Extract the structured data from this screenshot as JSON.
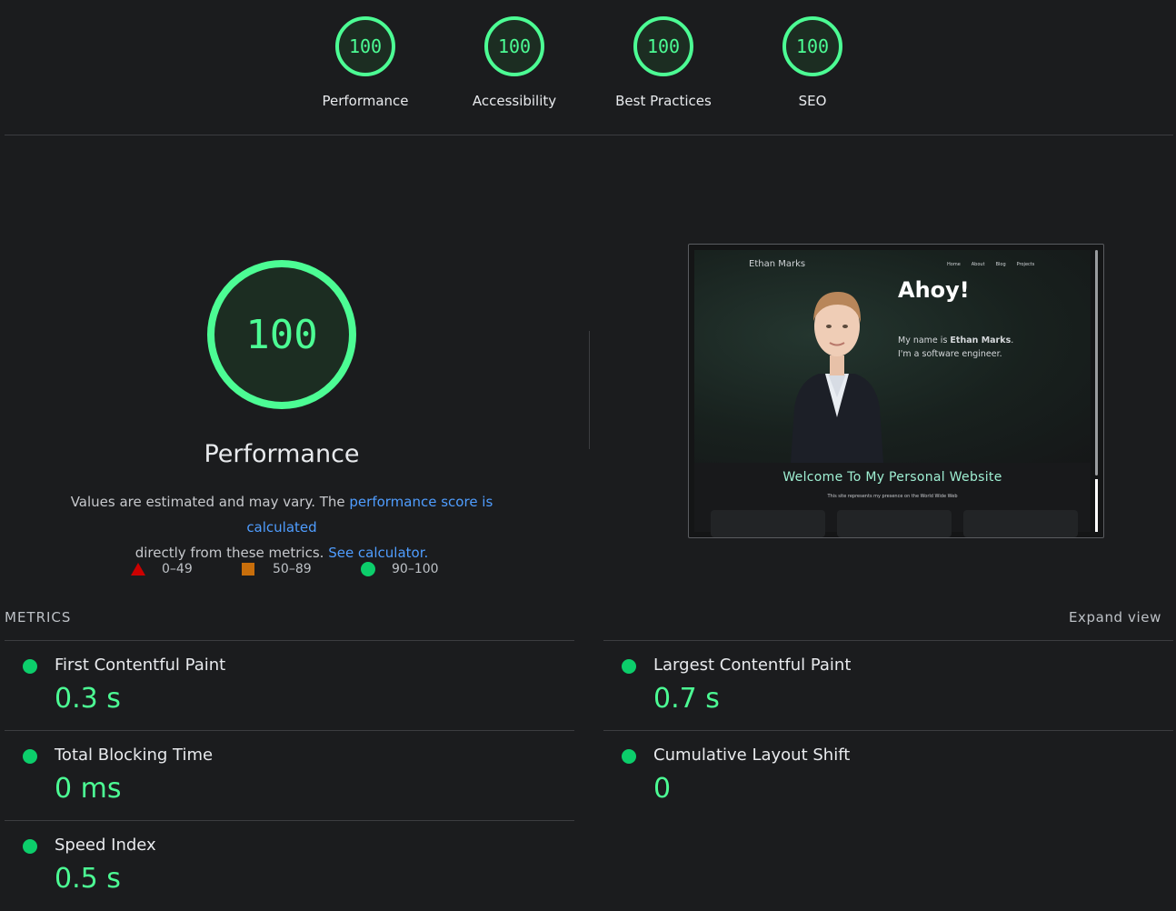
{
  "gauges": [
    {
      "score": "100",
      "label": "Performance"
    },
    {
      "score": "100",
      "label": "Accessibility"
    },
    {
      "score": "100",
      "label": "Best Practices"
    },
    {
      "score": "100",
      "label": "SEO"
    }
  ],
  "performance": {
    "score": "100",
    "title": "Performance",
    "desc_prefix": "Values are estimated and may vary. The ",
    "desc_link1": "performance score is calculated",
    "desc_middle": "directly from these metrics.",
    "desc_link2": "See calculator."
  },
  "legend": [
    {
      "range": "0–49",
      "color": "#cc0000"
    },
    {
      "range": "50–89",
      "color": "#c86e0b"
    },
    {
      "range": "90–100",
      "color": "#0cce6b"
    }
  ],
  "screenshot": {
    "brand": "Ethan Marks",
    "nav": [
      "Home",
      "About",
      "Blog",
      "Projects"
    ],
    "heading": "Ahoy!",
    "intro_prefix": "My name is ",
    "intro_name": "Ethan Marks",
    "intro_suffix": ".",
    "intro_line2": "I'm a software engineer.",
    "welcome": "Welcome To My Personal Website",
    "subtext": "This site represents my presence on the World Wide Web"
  },
  "metrics_section": {
    "heading": "METRICS",
    "expand_label": "Expand view"
  },
  "metrics": [
    {
      "title": "First Contentful Paint",
      "value": "0.3 s"
    },
    {
      "title": "Largest Contentful Paint",
      "value": "0.7 s"
    },
    {
      "title": "Total Blocking Time",
      "value": "0 ms"
    },
    {
      "title": "Cumulative Layout Shift",
      "value": "0"
    },
    {
      "title": "Speed Index",
      "value": "0.5 s"
    }
  ],
  "colors": {
    "pass": "#0cce6b",
    "pass_text": "#4cfc94",
    "link": "#4f9dff",
    "background": "#1b1c1e"
  }
}
